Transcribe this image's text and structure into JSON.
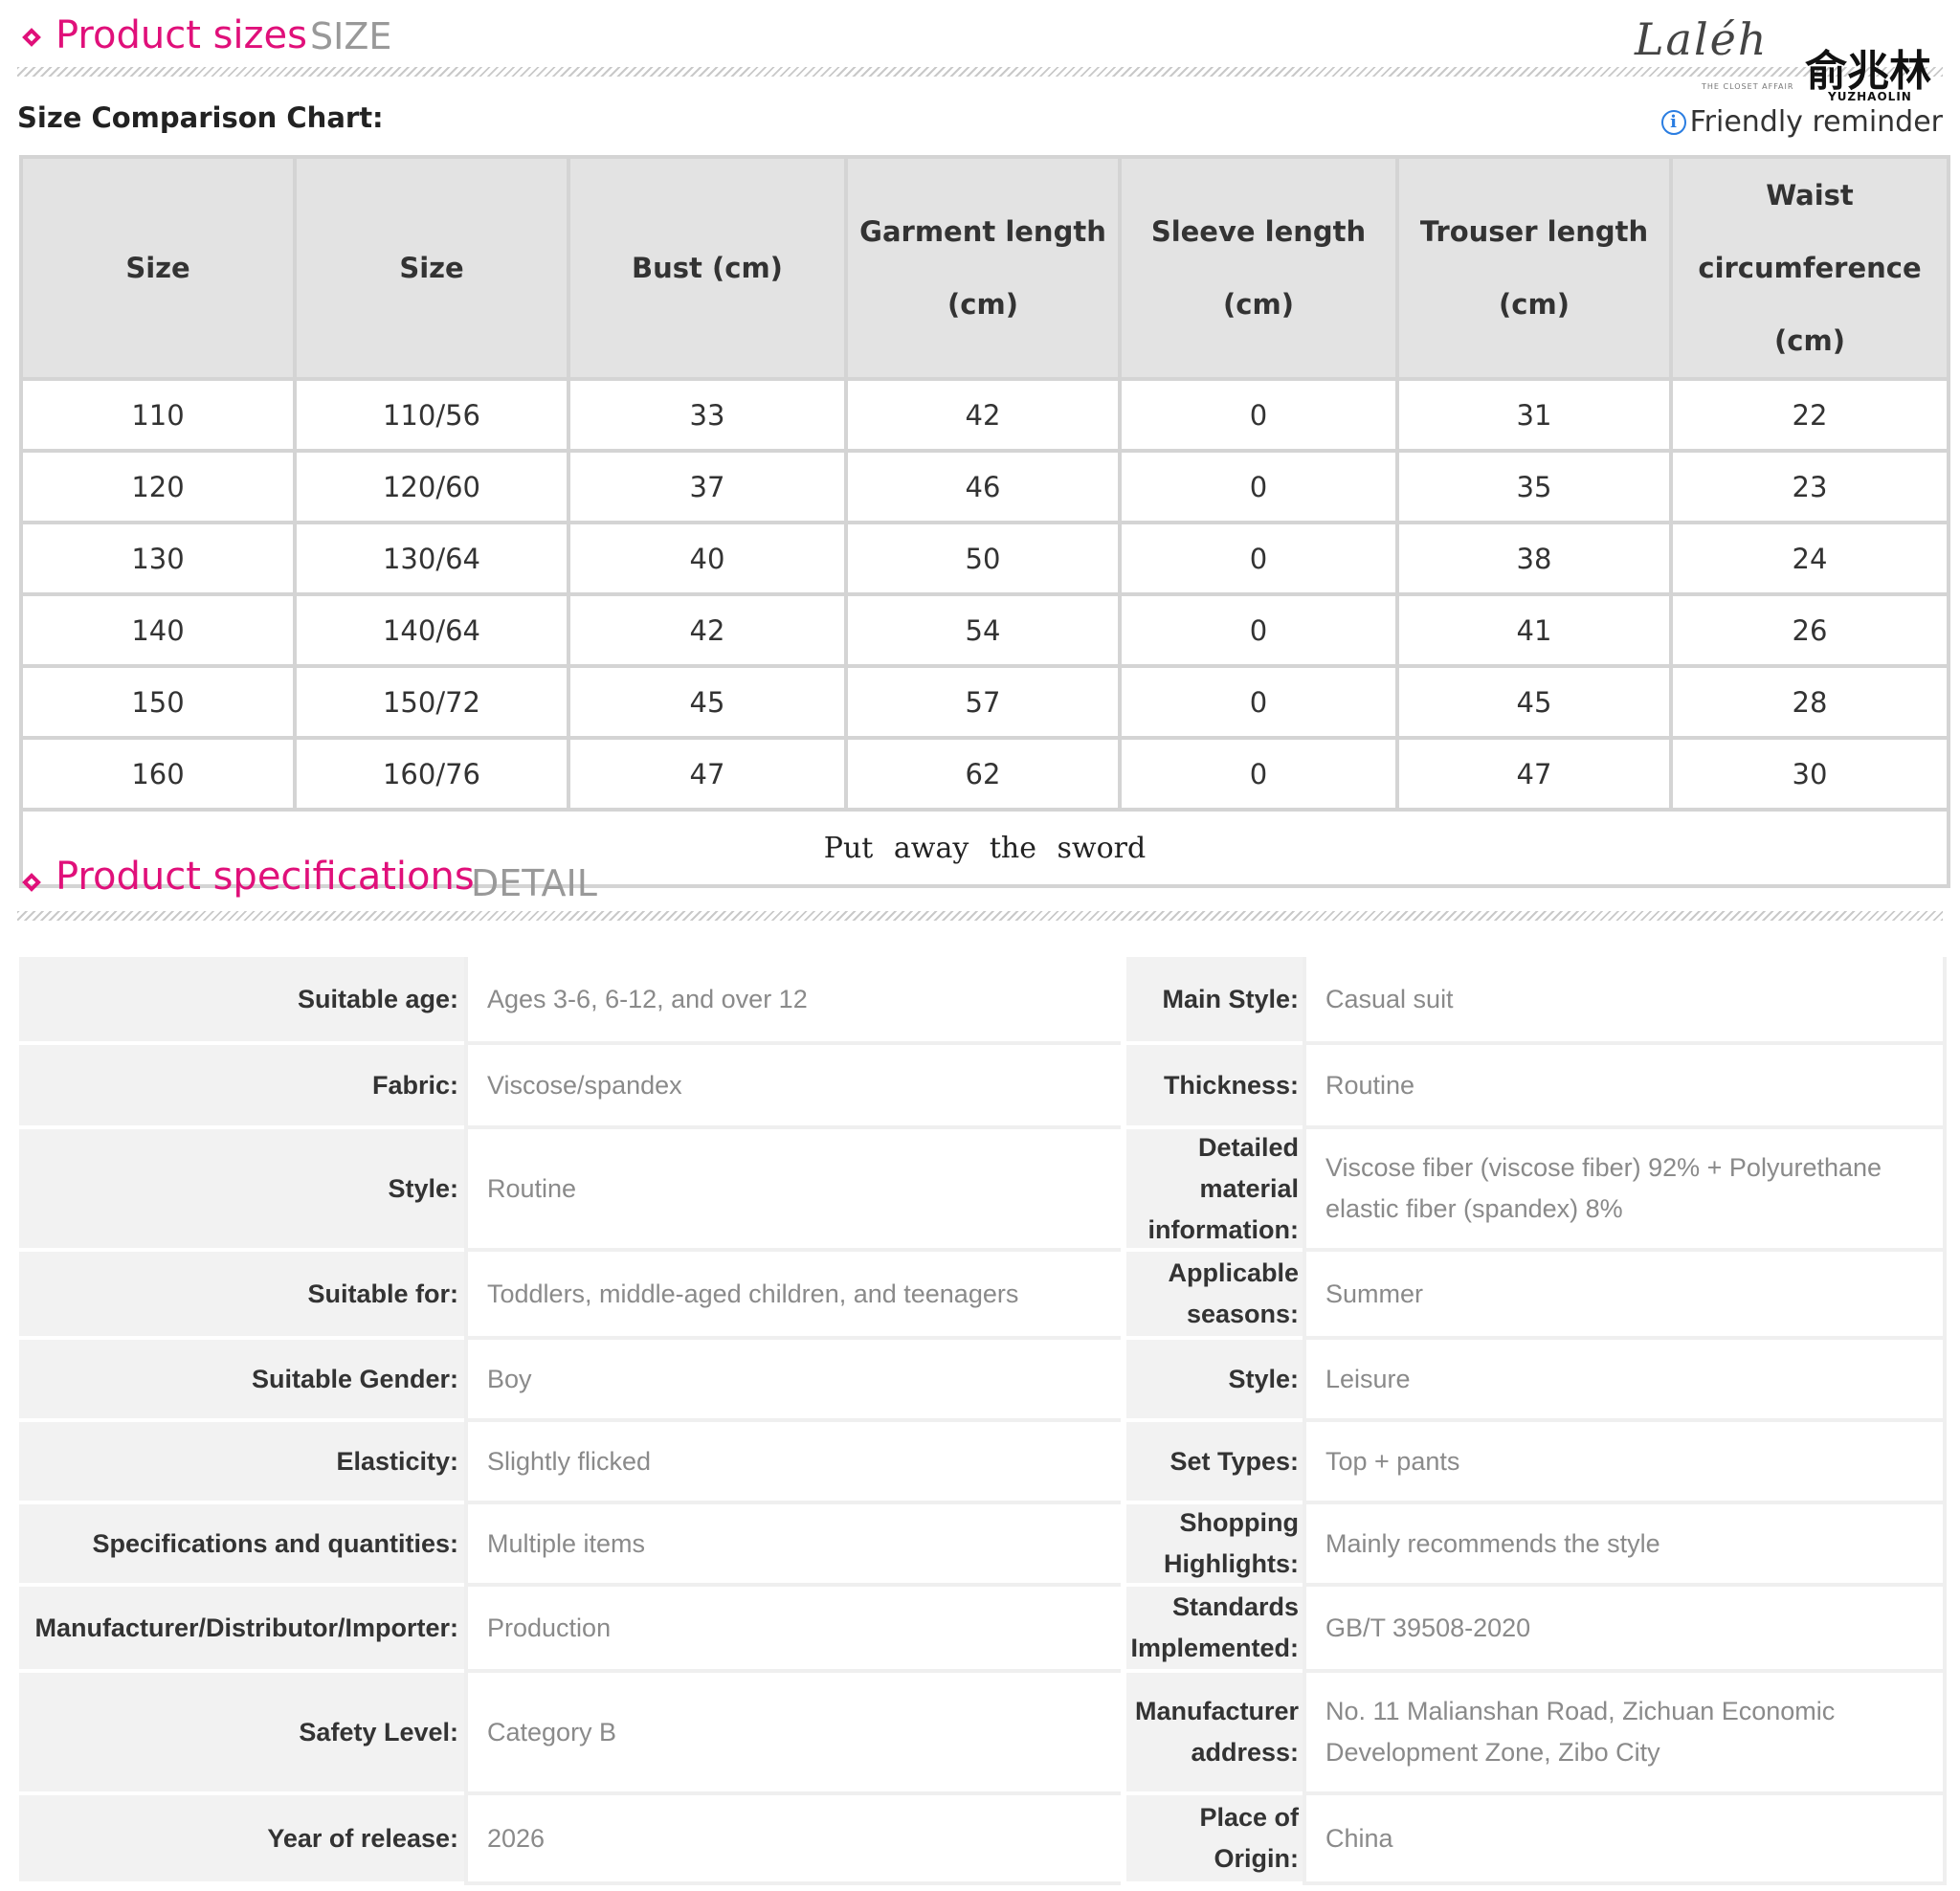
{
  "size_section": {
    "title": "Product sizes",
    "title_en": "SIZE",
    "chart_label": "Size Comparison Chart:",
    "reminder": "Friendly reminder"
  },
  "brand": {
    "script": "Laléh",
    "script_sub": "THE CLOSET AFFAIR",
    "chinese": "俞兆林",
    "pinyin": "YUZHAOLIN"
  },
  "size_table": {
    "headers": [
      "Size",
      "Size",
      "Bust (cm)",
      "Garment length (cm)",
      "Sleeve length (cm)",
      "Trouser length (cm)",
      "Waist circumference (cm)"
    ],
    "rows": [
      [
        "110",
        "110/56",
        "33",
        "42",
        "0",
        "31",
        "22"
      ],
      [
        "120",
        "120/60",
        "37",
        "46",
        "0",
        "35",
        "23"
      ],
      [
        "130",
        "130/64",
        "40",
        "50",
        "0",
        "38",
        "24"
      ],
      [
        "140",
        "140/64",
        "42",
        "54",
        "0",
        "41",
        "26"
      ],
      [
        "150",
        "150/72",
        "45",
        "57",
        "0",
        "45",
        "28"
      ],
      [
        "160",
        "160/76",
        "47",
        "62",
        "0",
        "47",
        "30"
      ]
    ],
    "footer": "Put away the sword"
  },
  "detail_section": {
    "title": "Product specifications",
    "title_en": "DETAIL"
  },
  "details": [
    {
      "left_label": "Suitable age:",
      "left_value": "Ages 3-6, 6-12, and over 12",
      "right_label": "Main Style:",
      "right_value": "Casual suit"
    },
    {
      "left_label": "Fabric:",
      "left_value": "Viscose/spandex",
      "right_label": "Thickness:",
      "right_value": "Routine"
    },
    {
      "left_label": "Style:",
      "left_value": "Routine",
      "right_label": "Detailed material information:",
      "right_value": "Viscose fiber (viscose fiber) 92% + Polyurethane elastic fiber (spandex) 8%"
    },
    {
      "left_label": "Suitable for:",
      "left_value": "Toddlers, middle-aged children, and teenagers",
      "right_label": "Applicable seasons:",
      "right_value": "Summer"
    },
    {
      "left_label": "Suitable Gender:",
      "left_value": "Boy",
      "right_label": "Style:",
      "right_value": "Leisure"
    },
    {
      "left_label": "Elasticity:",
      "left_value": "Slightly flicked",
      "right_label": "Set Types:",
      "right_value": "Top + pants"
    },
    {
      "left_label": "Specifications and quantities:",
      "left_value": "Multiple items",
      "right_label": "Shopping Highlights:",
      "right_value": "Mainly recommends the style"
    },
    {
      "left_label": "Manufacturer/Distributor/Importer:",
      "left_value": "Production",
      "right_label": "Standards Implemented:",
      "right_value": "GB/T 39508-2020"
    },
    {
      "left_label": "Safety Level:",
      "left_value": "Category B",
      "right_label": "Manufacturer address:",
      "right_value": "No. 11 Malianshan Road, Zichuan Economic Development Zone, Zibo City"
    },
    {
      "left_label": "Year of release:",
      "left_value": "2026",
      "right_label": "Place of Origin:",
      "right_value": "China"
    }
  ]
}
